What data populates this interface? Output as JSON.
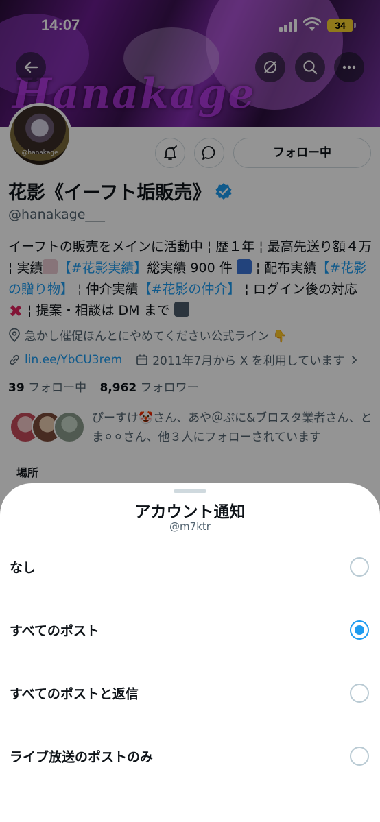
{
  "status_bar": {
    "time": "14:07",
    "battery": "34"
  },
  "banner": {
    "text": "Hanakage"
  },
  "profile": {
    "avatar_text": "@hanakage",
    "follow_button": "フォロー中",
    "name": "花影《イーフト垢販売》",
    "handle": "@hanakage___",
    "bio": {
      "p1": "イーフトの販売をメインに活動中 ¦ 歴１年 ¦ 最高先送り額４万 ¦ 実績",
      "tag1": "【#花影実績】",
      "p2": "総実績 900 件",
      "p3": " ¦ 配布実績",
      "tag2": "【#花影の贈り物】",
      "p4": " ¦ 仲介実績",
      "tag3": "【#花影の仲介】",
      "p5": " ¦ ログイン後の対応",
      "p6": " ¦ 提案・相談は DM まで"
    },
    "location": "急かし催促ほんとにやめてください公式ライン 👇",
    "link": "lin.ee/YbCU3rem",
    "joined": "2011年7月から X を利用しています",
    "following_count": "39",
    "following_label": "フォロー中",
    "followers_count": "8,962",
    "followers_label": "フォロワー",
    "followed_by": "ぴーすけ🤡さん、あや＠ぷに&ブロスタ業者さん、とま⚪︎⚪︎さん、他３人にフォローされています",
    "section_label": "場所"
  },
  "sheet": {
    "title": "アカウント通知",
    "subtitle": "@m7ktr",
    "options": [
      {
        "label": "なし",
        "selected": false
      },
      {
        "label": "すべてのポスト",
        "selected": true
      },
      {
        "label": "すべてのポストと返信",
        "selected": false
      },
      {
        "label": "ライブ放送のポストのみ",
        "selected": false
      }
    ]
  },
  "colors": {
    "accent": "#1d9bf0",
    "text": "#0f1419",
    "secondary": "#536471"
  }
}
